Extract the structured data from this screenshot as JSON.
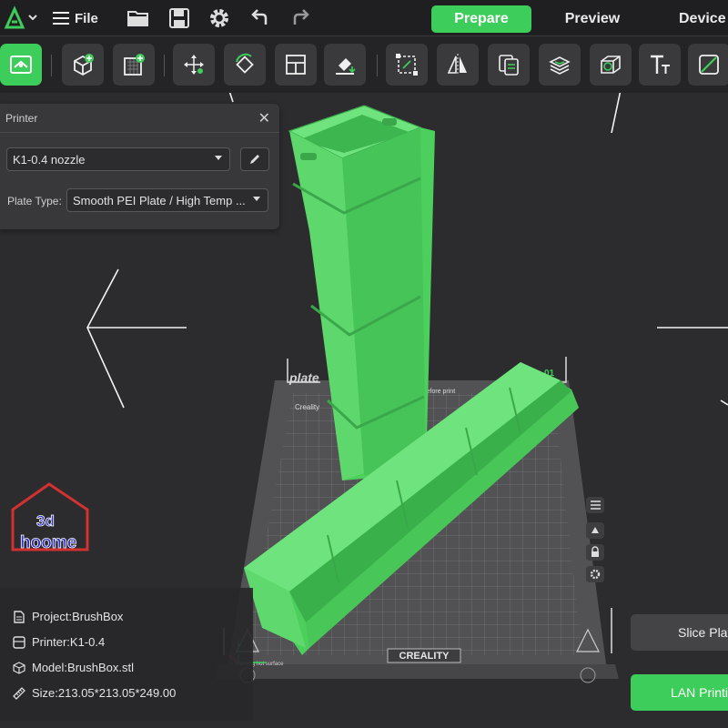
{
  "menubar": {
    "file_label": "File",
    "tabs": [
      {
        "label": "Prepare",
        "active": true
      },
      {
        "label": "Preview",
        "active": false
      },
      {
        "label": "Device",
        "active": false
      }
    ]
  },
  "toolbar": {
    "icons": [
      "view-icon",
      "add-object-icon",
      "add-plate-icon",
      "move-icon",
      "rotate-icon",
      "arrange-icon",
      "lay-flat-icon",
      "scale-icon",
      "mirror-icon",
      "copy-icon",
      "cut-icon",
      "support-icon",
      "text-icon",
      "split-icon"
    ]
  },
  "printer_panel": {
    "title": "Printer",
    "printer_value": "K1-0.4 nozzle",
    "plate_type_label": "Plate Type:",
    "plate_type_value": "Smooth PEI Plate / High Temp ..."
  },
  "bed": {
    "plate_name": "plate",
    "plate_number": "01",
    "brand": "CREALITY",
    "brand_small": "Creality",
    "notice": "ue before print",
    "warning": "Warning hot surface"
  },
  "info": {
    "project": "Project:BrushBox",
    "printer": "Printer:K1-0.4",
    "model": "Model:BrushBox.stl",
    "size": "Size:213.05*213.05*249.00"
  },
  "buttons": {
    "slice": "Slice Plate",
    "lan_print": "LAN Printing"
  },
  "watermark": {
    "line1": "3d",
    "line2": "hoome"
  },
  "colors": {
    "accent": "#3ccd5a",
    "model": "#4ccf5c",
    "background": "#2b2b2d"
  }
}
